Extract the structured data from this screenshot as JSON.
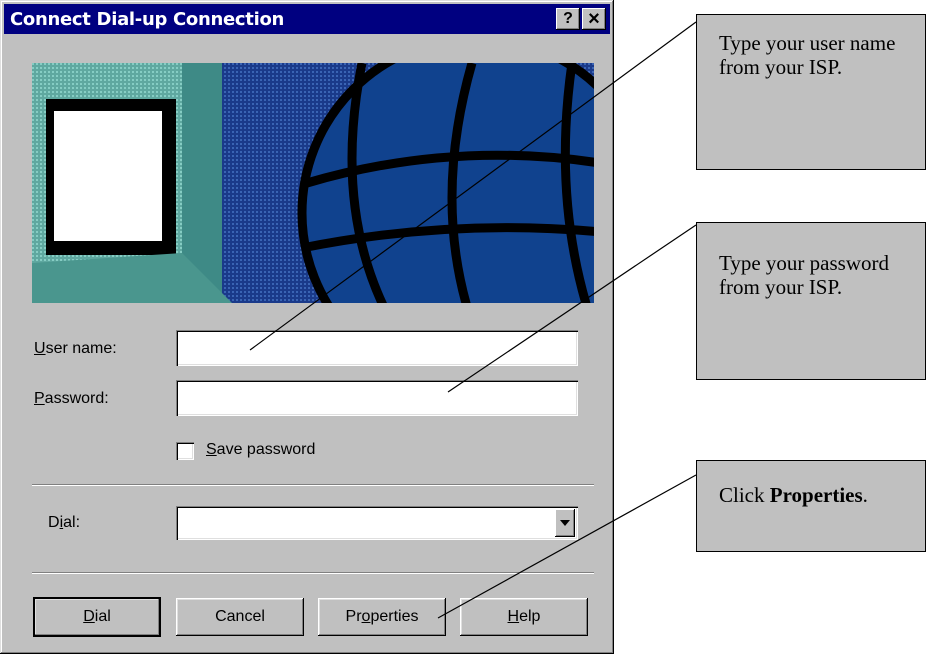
{
  "window": {
    "title": "Connect Dial-up Connection",
    "help_glyph": "?",
    "close_glyph": "×"
  },
  "form": {
    "username": {
      "label": "User name:",
      "accel": "U",
      "rest": "ser name:",
      "value": ""
    },
    "password": {
      "label": "Password:",
      "accel": "P",
      "rest": "assword:",
      "value": ""
    },
    "save_password": {
      "label": "Save password",
      "accel": "S",
      "rest": "ave password",
      "checked": false
    },
    "dial": {
      "label": "Dial:",
      "pre": "D",
      "accel": "i",
      "rest": "al:",
      "value": ""
    }
  },
  "buttons": {
    "dial": {
      "label": "Dial",
      "accel": "D",
      "rest": "ial"
    },
    "cancel": {
      "label": "Cancel"
    },
    "properties": {
      "label": "Properties",
      "pre": "Pr",
      "accel": "o",
      "rest": "perties"
    },
    "help": {
      "label": "Help",
      "accel": "H",
      "rest": "elp"
    }
  },
  "callouts": [
    {
      "text": "Type your user name from your ISP."
    },
    {
      "text": "Type your password from your ISP."
    },
    {
      "text_before": "Click ",
      "bold": "Properties",
      "text_after": "."
    }
  ],
  "icons": [
    "help-icon",
    "close-icon",
    "computer-globe-banner",
    "dropdown-arrow-icon"
  ]
}
